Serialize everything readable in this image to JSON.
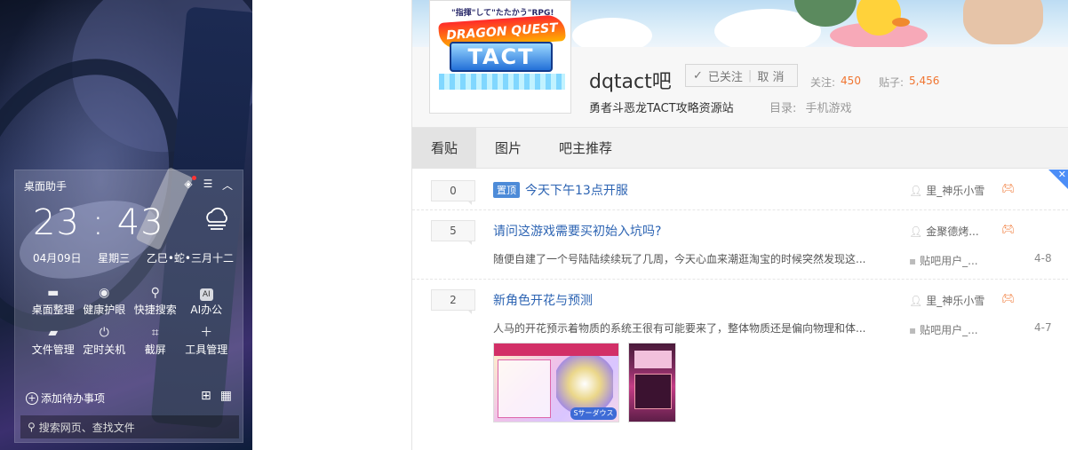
{
  "desktop_widget": {
    "title": "桌面助手",
    "time": "23 : 43",
    "date": "04月09日",
    "weekday": "星期三",
    "lunar": "乙巳•蛇•三月十二",
    "tools": [
      {
        "label": "桌面整理",
        "icon": "desktop-icon"
      },
      {
        "label": "健康护眼",
        "icon": "eye-icon"
      },
      {
        "label": "快捷搜索",
        "icon": "search-icon"
      },
      {
        "label": "AI办公",
        "icon": "ai-icon",
        "badge": "AI"
      },
      {
        "label": "文件管理",
        "icon": "folder-icon"
      },
      {
        "label": "定时关机",
        "icon": "power-icon"
      },
      {
        "label": "截屏",
        "icon": "crop-icon"
      },
      {
        "label": "工具管理",
        "icon": "plus-icon"
      }
    ],
    "todo_label": "添加待办事项",
    "search_placeholder": "搜索网页、查找文件"
  },
  "forum": {
    "name": "dqtact吧",
    "follow_label": "已关注",
    "cancel_label": "取 消",
    "follow_count_label": "关注:",
    "follow_count": "450",
    "post_count_label": "贴子:",
    "post_count": "5,456",
    "slogan": "勇者斗恶龙TACT攻略资源站",
    "directory_label": "目录:",
    "directory_value": "手机游戏",
    "logo_top_text": "\"指揮\"して\"たたかう\"RPG!",
    "logo_title_text": "DRAGON QUEST",
    "logo_sub_text": "TACT"
  },
  "tabs": [
    {
      "label": "看贴",
      "active": true
    },
    {
      "label": "图片",
      "active": false
    },
    {
      "label": "吧主推荐",
      "active": false
    }
  ],
  "threads": [
    {
      "replies": "0",
      "pinned": true,
      "pin_label": "置顶",
      "title": "今天下午13点开服",
      "author": "里_神乐小雪",
      "abstract": "",
      "last_user": "",
      "time": ""
    },
    {
      "replies": "5",
      "pinned": false,
      "title": "请问这游戏需要买初始入坑吗?",
      "author": "金聚德烤...",
      "abstract": "随便自建了一个号陆陆续续玩了几周，今天心血来潮逛淘宝的时候突然发现这...",
      "last_user": "贴吧用户_...",
      "time": "4-8"
    },
    {
      "replies": "2",
      "pinned": false,
      "title": "新角色开花与预测",
      "author": "里_神乐小雪",
      "abstract": "人马的开花预示着物质的系统王很有可能要来了，整体物质还是偏向物理和体...",
      "last_user": "贴吧用户_...",
      "time": "4-7"
    }
  ],
  "thumb_tag_text": "Sサーダウス"
}
